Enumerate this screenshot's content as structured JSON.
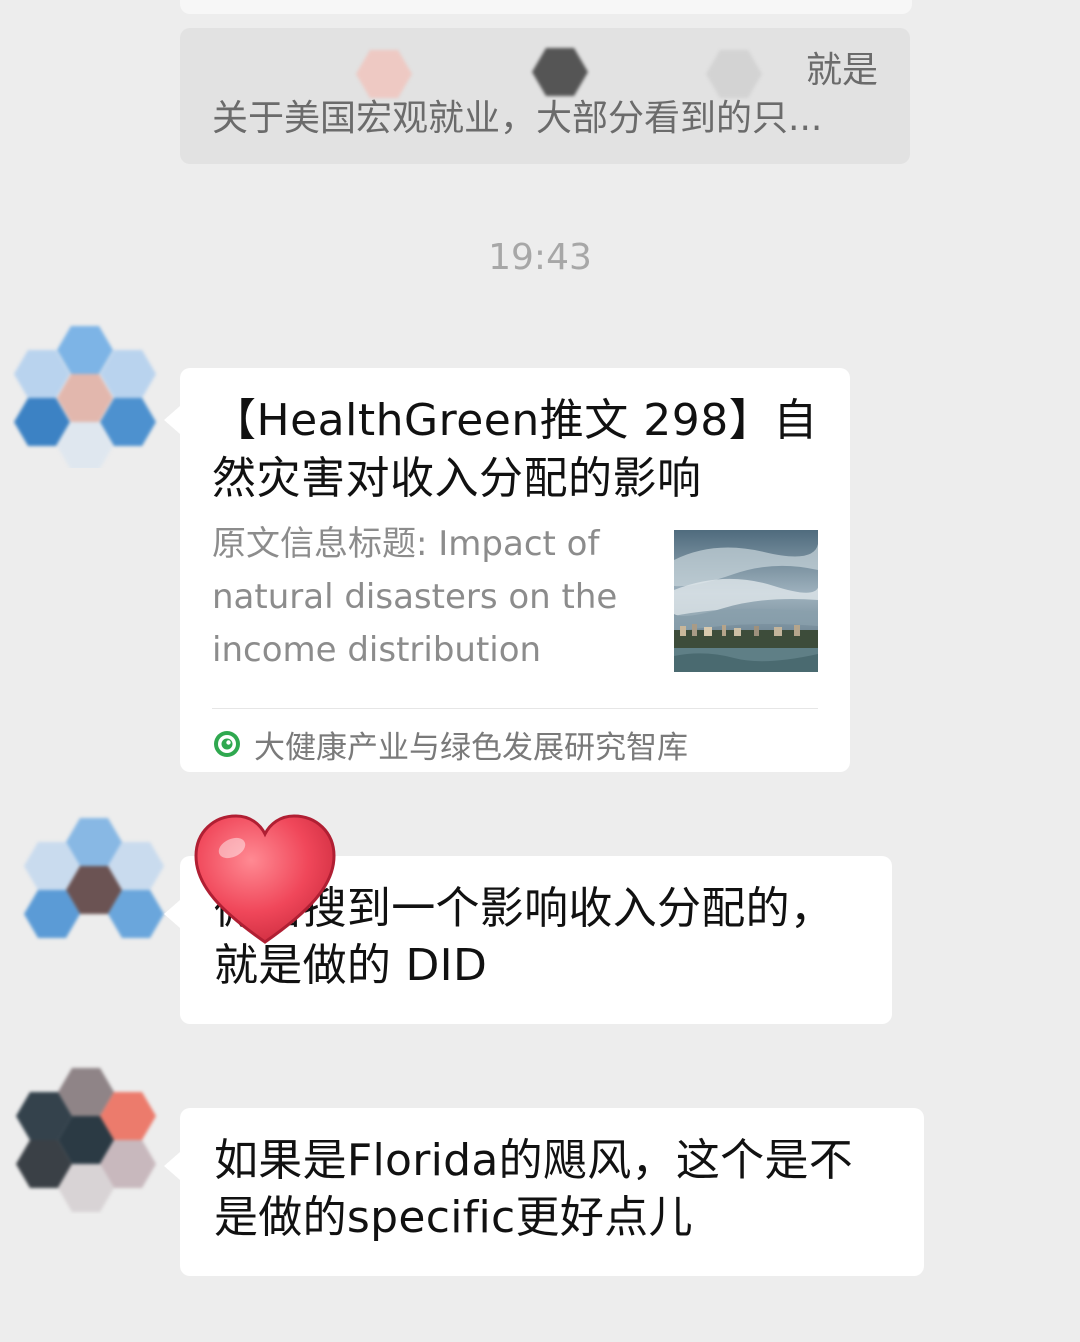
{
  "quoted_message": {
    "line1": "就是",
    "line2": "关于美国宏观就业，大部分看到的只..."
  },
  "timestamp": "19:43",
  "messages": [
    {
      "type": "article_card",
      "title": "【HealthGreen推文 298】自然灾害对收入分配的影响",
      "description": "原文信息标题: Impact of natural disasters on the income distribution",
      "thumbnail": "storm-cloud-image",
      "source": "大健康产业与绿色发展研究智库",
      "source_icon": "green-circle-logo-icon"
    },
    {
      "type": "text",
      "text": "微信搜到一个影响收入分配的，就是做的 DID",
      "reaction": "heart-sticker"
    },
    {
      "type": "text",
      "text": "如果是Florida的飓风，这个是不是做的specific更好点儿"
    }
  ],
  "colors": {
    "background": "#ededed",
    "bubble": "#ffffff",
    "quote_block": "#e2e2e2",
    "timestamp": "#a7a7a7",
    "description": "#8c8c8c",
    "heart": "#e8424e"
  }
}
